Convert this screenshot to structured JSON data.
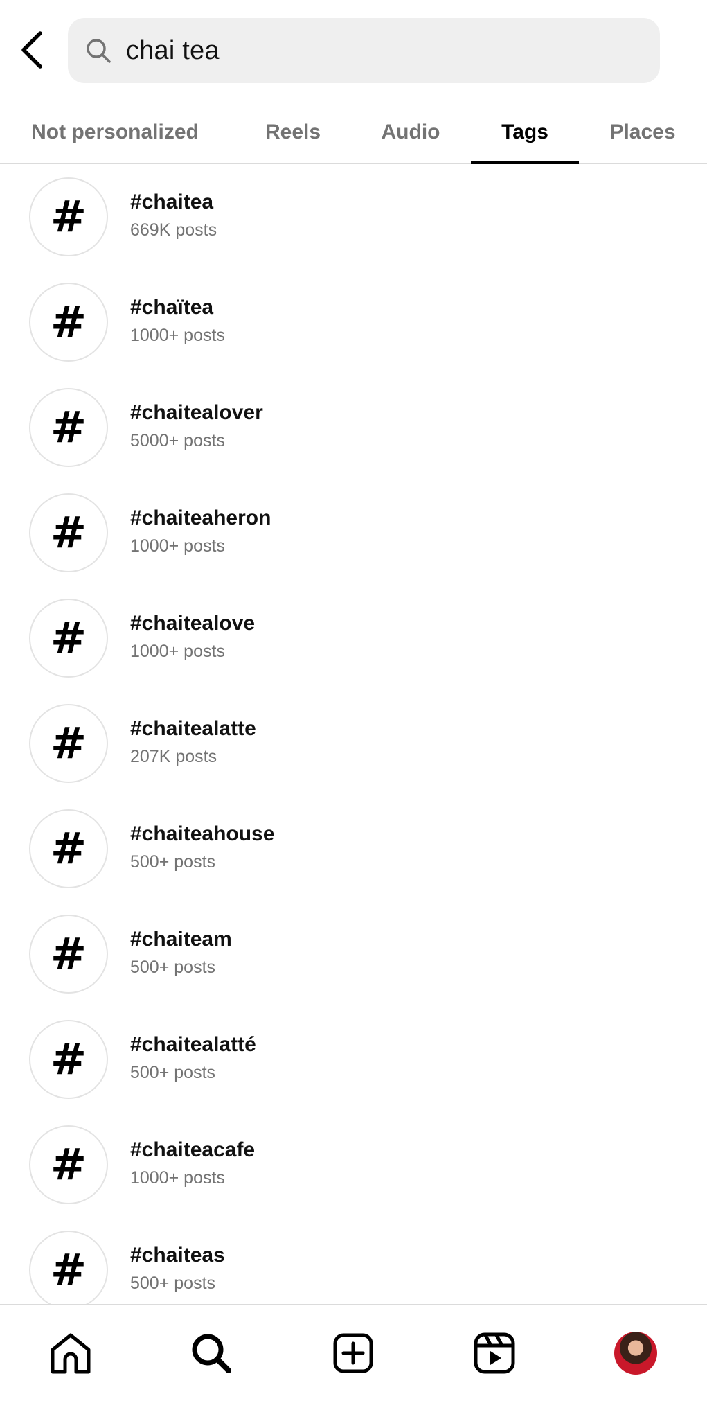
{
  "search": {
    "query": "chai tea"
  },
  "tabs": [
    {
      "label": "Not personalized",
      "active": false
    },
    {
      "label": "Reels",
      "active": false
    },
    {
      "label": "Audio",
      "active": false
    },
    {
      "label": "Tags",
      "active": true
    },
    {
      "label": "Places",
      "active": false
    }
  ],
  "results": [
    {
      "tag": "#chaitea",
      "count": "669K posts"
    },
    {
      "tag": "#chaïtea",
      "count": "1000+ posts"
    },
    {
      "tag": "#chaitealover",
      "count": "5000+ posts"
    },
    {
      "tag": "#chaiteaheron",
      "count": "1000+ posts"
    },
    {
      "tag": "#chaitealove",
      "count": "1000+ posts"
    },
    {
      "tag": "#chaitealatte",
      "count": "207K posts"
    },
    {
      "tag": "#chaiteahouse",
      "count": "500+ posts"
    },
    {
      "tag": "#chaiteam",
      "count": "500+ posts"
    },
    {
      "tag": "#chaitealatté",
      "count": "500+ posts"
    },
    {
      "tag": "#chaiteacafe",
      "count": "1000+ posts"
    },
    {
      "tag": "#chaiteas",
      "count": "500+ posts"
    }
  ],
  "hash_symbol": "#",
  "icons": {
    "back": "chevron-left-icon",
    "search": "search-icon",
    "home": "home-icon",
    "explore": "search-icon",
    "create": "plus-square-icon",
    "reels": "reels-icon",
    "profile": "avatar"
  },
  "colors": {
    "search_bg": "#efefef",
    "muted_text": "#737373",
    "divider": "#dbdbdb"
  }
}
